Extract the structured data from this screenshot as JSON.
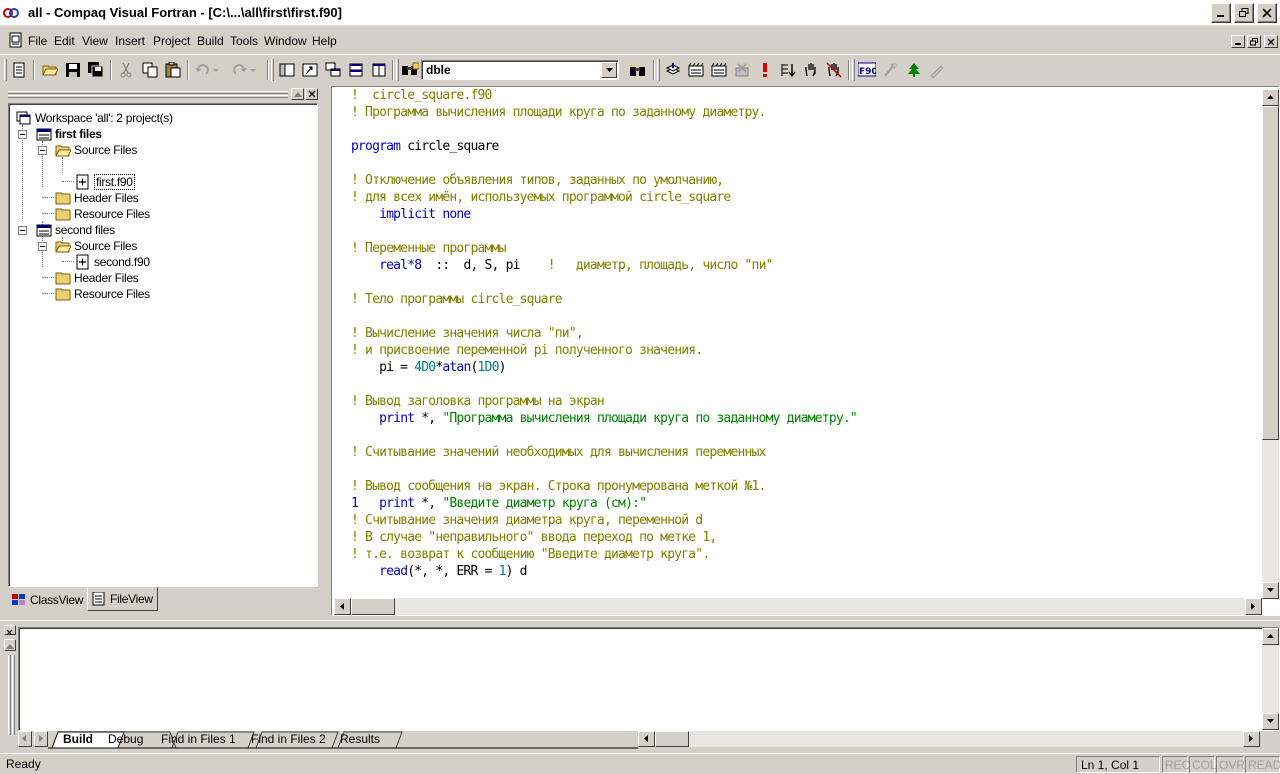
{
  "window": {
    "title": "all - Compaq Visual Fortran - [C:\\...\\all\\first\\first.f90]"
  },
  "menu": [
    "File",
    "Edit",
    "View",
    "Insert",
    "Project",
    "Build",
    "Tools",
    "Window",
    "Help"
  ],
  "toolbar": {
    "find_combo_value": "dble"
  },
  "workspace": {
    "root": "Workspace 'all': 2 project(s)",
    "projects": [
      {
        "name": "first files",
        "folders": [
          "Source Files",
          "Header Files",
          "Resource Files"
        ],
        "source_file": "first.f90"
      },
      {
        "name": "second files",
        "folders": [
          "Source Files",
          "Header Files",
          "Resource Files"
        ],
        "source_file": "second.f90"
      }
    ],
    "tabs": [
      "ClassView",
      "FileView"
    ]
  },
  "editor": {
    "lines": [
      [
        [
          "c",
          "!  circle_square.f90"
        ]
      ],
      [
        [
          "c",
          "! Программа вычисления площади круга по заданному диаметру."
        ]
      ],
      [],
      [
        [
          "k",
          "program"
        ],
        [
          "p",
          " circle_square"
        ]
      ],
      [],
      [
        [
          "c",
          "! Отключение объявления типов, заданных по умолчанию,"
        ]
      ],
      [
        [
          "c",
          "! для всех имён, используемых программой circle_square"
        ]
      ],
      [
        [
          "p",
          "    "
        ],
        [
          "k",
          "implicit none"
        ]
      ],
      [],
      [
        [
          "c",
          "! Переменные программы"
        ]
      ],
      [
        [
          "p",
          "    "
        ],
        [
          "k",
          "real*8"
        ],
        [
          "p",
          "  ::  d, S, pi    "
        ],
        [
          "c",
          "!   диаметр, площадь, число \"пи\""
        ]
      ],
      [],
      [
        [
          "c",
          "! Тело программы circle_square"
        ]
      ],
      [],
      [
        [
          "c",
          "! Вычисление значения числа \"пи\","
        ]
      ],
      [
        [
          "c",
          "! и присвоение переменной pi полученного значения."
        ]
      ],
      [
        [
          "p",
          "    pi = "
        ],
        [
          "n",
          "4D0"
        ],
        [
          "p",
          "*"
        ],
        [
          "k",
          "atan"
        ],
        [
          "p",
          "("
        ],
        [
          "n",
          "1D0"
        ],
        [
          "p",
          ")"
        ]
      ],
      [],
      [
        [
          "c",
          "! Вывод заголовка программы на экран"
        ]
      ],
      [
        [
          "p",
          "    "
        ],
        [
          "k",
          "print"
        ],
        [
          "p",
          " *, "
        ],
        [
          "s",
          "\"Программа вычисления площади круга по заданному диаметру.\""
        ]
      ],
      [],
      [
        [
          "c",
          "! Считывание значений необходимых для вычисления переменных"
        ]
      ],
      [],
      [
        [
          "c",
          "! Вывод сообщения на экран. Строка пронумерована меткой №1."
        ]
      ],
      [
        [
          "l",
          "1"
        ],
        [
          "p",
          "   "
        ],
        [
          "k",
          "print"
        ],
        [
          "p",
          " *, "
        ],
        [
          "s",
          "\"Введите диаметр круга (см):\""
        ]
      ],
      [
        [
          "c",
          "! Считывание значения диаметра круга, переменной d"
        ]
      ],
      [
        [
          "c",
          "! В случае \"неправильного\" ввода переход по метке 1,"
        ]
      ],
      [
        [
          "c",
          "! т.е. возврат к сообщению \"Введите диаметр круга\"."
        ]
      ],
      [
        [
          "p",
          "    "
        ],
        [
          "k",
          "read"
        ],
        [
          "p",
          "(*, *, ERR = "
        ],
        [
          "n",
          "1"
        ],
        [
          "p",
          ") d"
        ]
      ]
    ]
  },
  "output": {
    "tabs": [
      "Build",
      "Debug",
      "Find in Files 1",
      "Find in Files 2",
      "Results"
    ]
  },
  "status": {
    "text": "Ready",
    "position": "Ln 1, Col 1",
    "indicators": [
      "REC",
      "COL",
      "OVR",
      "READ"
    ]
  }
}
